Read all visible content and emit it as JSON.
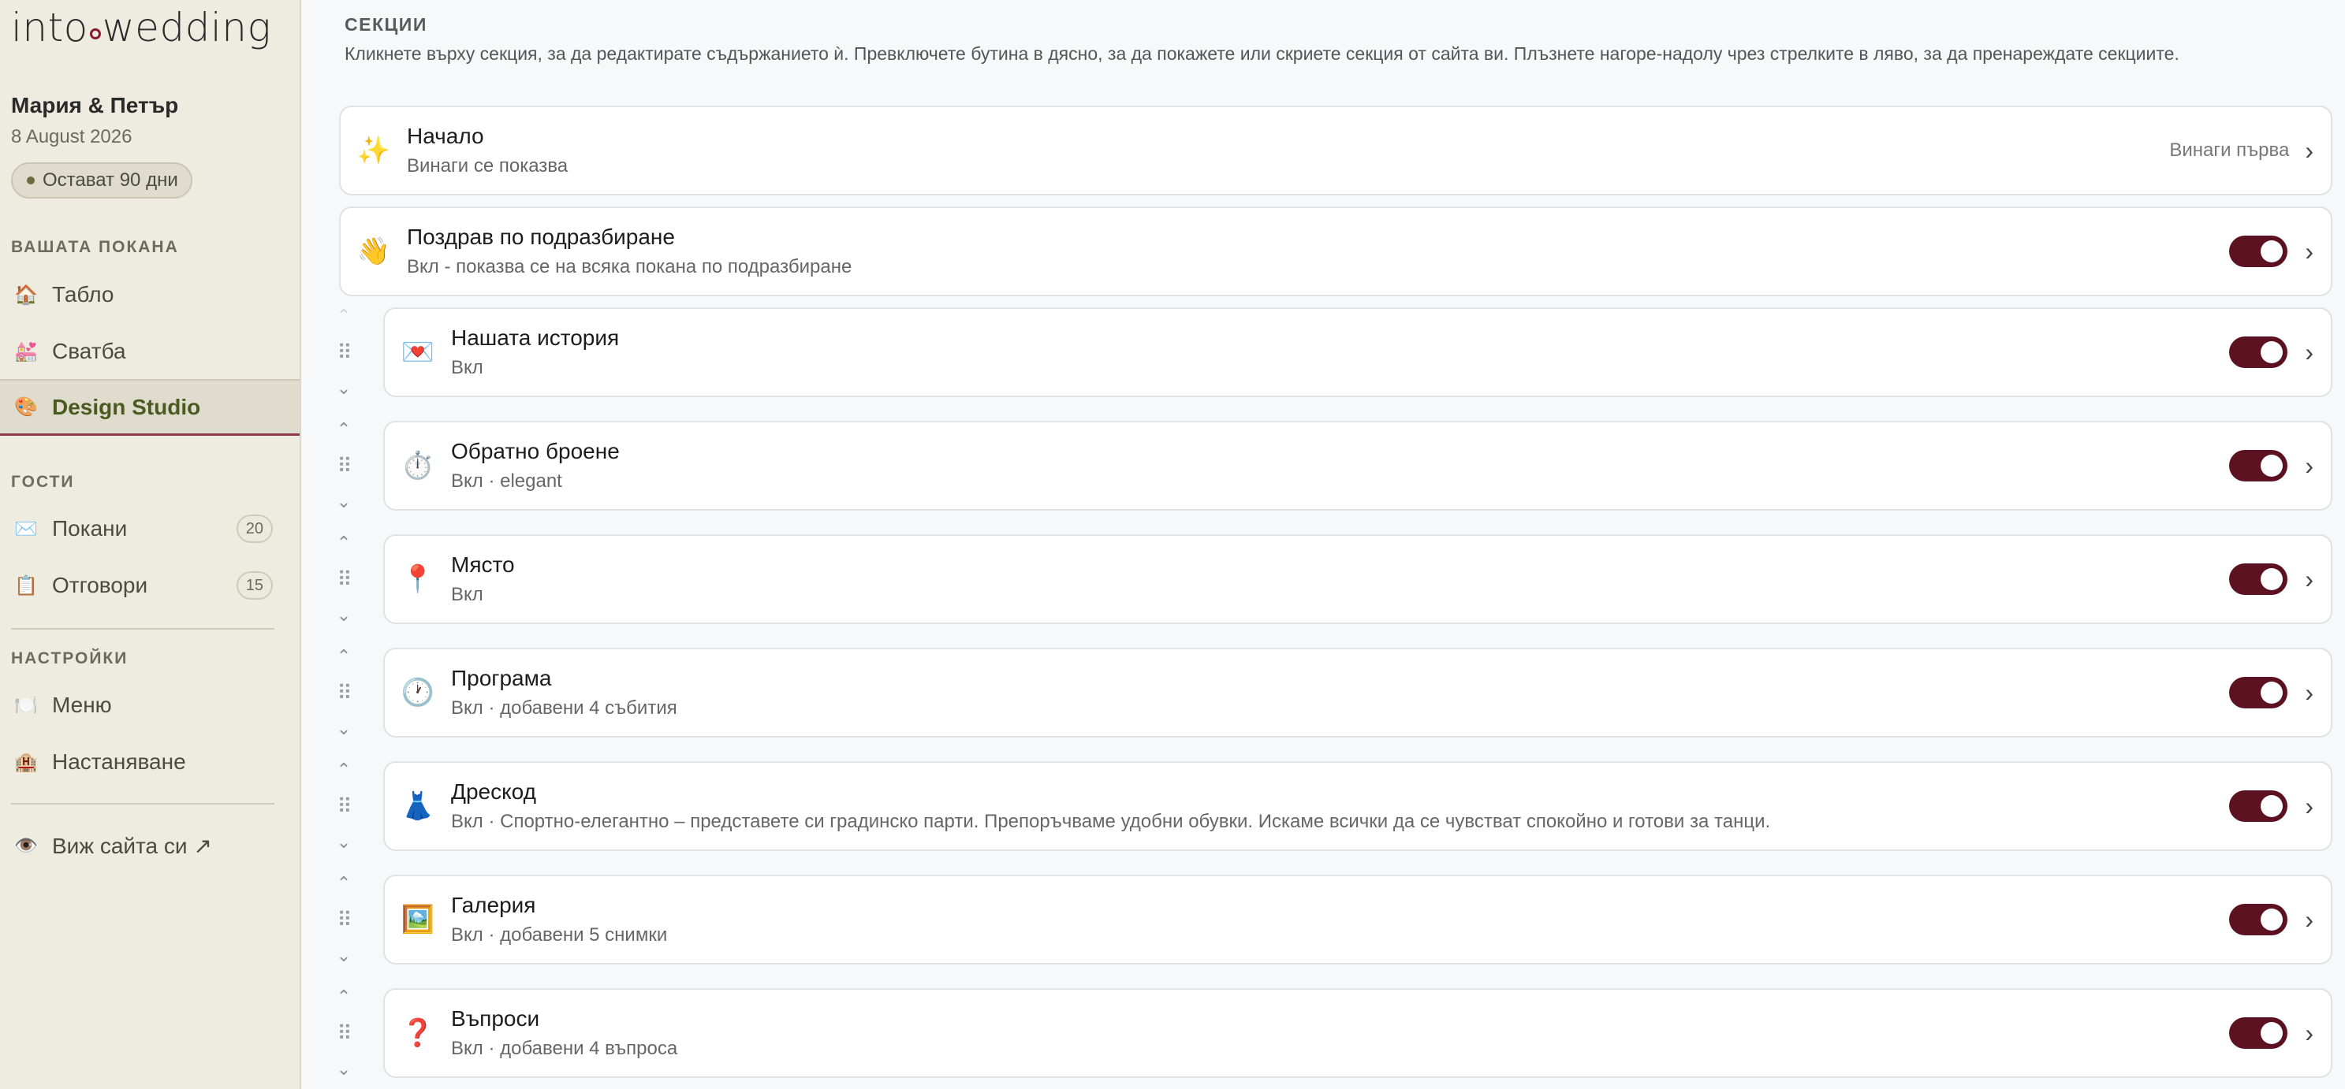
{
  "sidebar": {
    "logo_left": "into",
    "logo_right": "wedding",
    "couple": "Мария & Петър",
    "date": "8 August 2026",
    "days_left": "Остават 90 дни",
    "sections": {
      "invite": "ВАШАТА ПОКАНА",
      "guests": "ГОСТИ",
      "settings": "НАСТРОЙКИ"
    },
    "items": [
      {
        "label": "Табло",
        "icon": "🏠"
      },
      {
        "label": "Сватба",
        "icon": "💒"
      },
      {
        "label": "Design Studio",
        "icon": "🎨"
      },
      {
        "label": "Покани",
        "icon": "✉️",
        "count": "20"
      },
      {
        "label": "Отговори",
        "icon": "📋",
        "count": "15"
      },
      {
        "label": "Меню",
        "icon": "🍽️"
      },
      {
        "label": "Настаняване",
        "icon": "🏨"
      },
      {
        "label": "Виж сайта си ↗",
        "icon": "👁️"
      }
    ]
  },
  "main": {
    "title": "СЕКЦИИ",
    "description": "Кликнете върху секция, за да редактирате съдържанието ѝ. Превключете бутина в дясно, за да покажете или скриете секция от сайта ви. Плъзнете нагоре-надолу чрез стрелките в ляво, за да пренареждате секциите.",
    "fixed_cards": [
      {
        "icon": "✨",
        "name": "Начало",
        "sub": "Винаги се показва",
        "right_label": "Винаги първа"
      },
      {
        "icon": "👋",
        "name": "Поздрав по подразбиране",
        "sub": "Вкл - показва се на всяка покана по подразбиране"
      }
    ],
    "cards": [
      {
        "icon": "💌",
        "name": "Нашата история",
        "sub": "Вкл"
      },
      {
        "icon": "⏱️",
        "name": "Обратно броене",
        "sub": "Вкл · elegant"
      },
      {
        "icon": "📍",
        "name": "Място",
        "sub": "Вкл"
      },
      {
        "icon": "🕐",
        "name": "Програма",
        "sub": "Вкл · добавени 4 събития"
      },
      {
        "icon": "👗",
        "name": "Дрескод",
        "sub": "Вкл · Спортно-елегантно – представете си градинско парти. Препоръчваме удобни обувки. Искаме всички да се чувстват спокойно и готови за танци."
      },
      {
        "icon": "🖼️",
        "name": "Галерия",
        "sub": "Вкл · добавени 5 снимки"
      },
      {
        "icon": "❓",
        "name": "Въпроси",
        "sub": "Вкл · добавени 4 въпроса"
      }
    ],
    "reorder": {
      "up": "⌃",
      "down": "⌄",
      "grip": "⠿"
    },
    "chevron": "›"
  }
}
